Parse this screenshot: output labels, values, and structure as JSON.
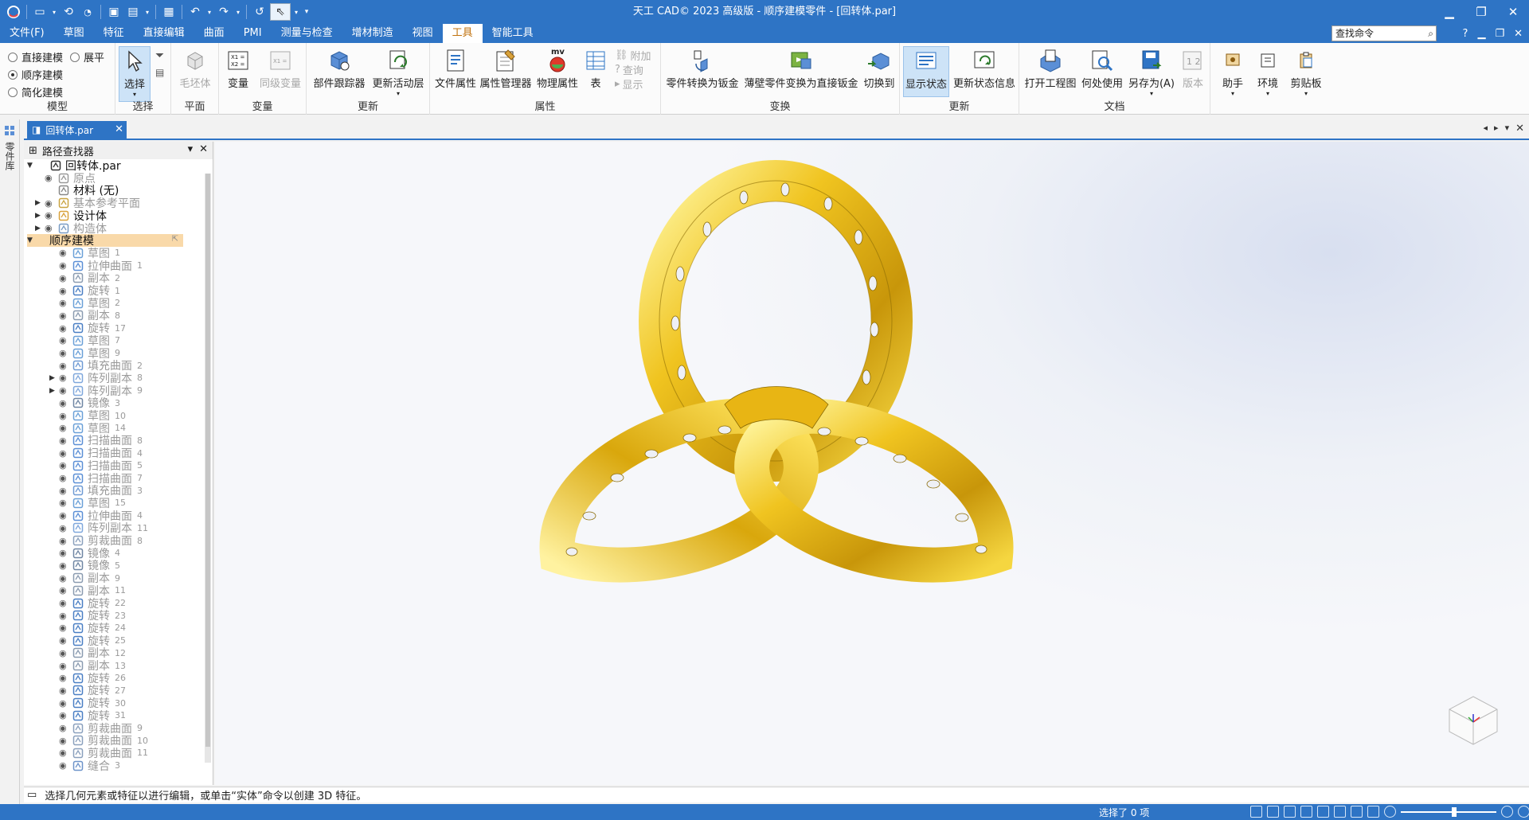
{
  "app": {
    "title": "天工 CAD© 2023 高级版 - 顺序建模零件 - [回转体.par]"
  },
  "menu": {
    "items": [
      "文件(F)",
      "草图",
      "特征",
      "直接编辑",
      "曲面",
      "PMI",
      "测量与检查",
      "增材制造",
      "视图",
      "工具",
      "智能工具"
    ],
    "active_index": 9,
    "search_placeholder": "查找命令",
    "help": "?"
  },
  "ribbon": {
    "model": {
      "opt1": "直接建模",
      "opt2": "展平",
      "opt3": "顺序建模",
      "opt4": "简化建模",
      "label": "模型"
    },
    "select": {
      "btn": "选择",
      "label": "选择"
    },
    "plane": {
      "btn": "毛坯体",
      "label": "平面"
    },
    "variable": {
      "btn1": "变量",
      "btn2": "同级变量",
      "label": "变量"
    },
    "update": {
      "btn1": "部件跟踪器",
      "btn2": "更新活动层",
      "label": "更新"
    },
    "props": {
      "btn1": "文件属性",
      "btn2": "属性管理器",
      "btn3": "物理属性",
      "btn4": "表",
      "small1": "附加",
      "small2": "查询",
      "small3": "显示",
      "mv": "mv",
      "label": "属性"
    },
    "convert": {
      "btn1": "零件转换为钣金",
      "btn2": "薄壁零件变换为直接钣金",
      "btn3": "切换到",
      "label": "变换"
    },
    "update2": {
      "btn1": "显示状态",
      "btn2": "更新状态信息",
      "label": "更新"
    },
    "docs": {
      "btn1": "打开工程图",
      "btn2": "何处使用",
      "btn3": "另存为(A)",
      "btn4": "版本",
      "label": "文档"
    },
    "extra": {
      "btn1": "助手",
      "btn2": "环境",
      "btn3": "剪贴板"
    }
  },
  "leftstrip": {
    "tab": "零件库"
  },
  "doc": {
    "tab": "回转体.par"
  },
  "pathfinder": {
    "title": "路径查找器",
    "tree": [
      {
        "label": "回转体.par",
        "num": "",
        "depth": 0,
        "twisty": "open",
        "style": "dark",
        "icon": "part-icon",
        "eye": false
      },
      {
        "label": "原点",
        "num": "",
        "depth": 1,
        "twisty": "",
        "style": "dim",
        "icon": "origin-icon",
        "eye": true
      },
      {
        "label": "材料 (无)",
        "num": "",
        "depth": 1,
        "twisty": "",
        "style": "dark",
        "icon": "material-icon",
        "eye": false
      },
      {
        "label": "基本参考平面",
        "num": "",
        "depth": 1,
        "twisty": "closed",
        "style": "dim",
        "icon": "plane-icon",
        "eye": true
      },
      {
        "label": "设计体",
        "num": "",
        "depth": 1,
        "twisty": "closed",
        "style": "dark",
        "icon": "design-body-icon",
        "eye": true
      },
      {
        "label": "构造体",
        "num": "",
        "depth": 1,
        "twisty": "closed",
        "style": "dim",
        "icon": "construction-icon",
        "eye": true
      },
      {
        "label": "顺序建模",
        "num": "",
        "depth": 0,
        "twisty": "open",
        "style": "hl",
        "icon": "",
        "eye": false
      },
      {
        "label": "草图",
        "num": "1",
        "depth": 2,
        "twisty": "",
        "style": "dim",
        "icon": "sketch-icon",
        "eye": true
      },
      {
        "label": "拉伸曲面",
        "num": "1",
        "depth": 2,
        "twisty": "",
        "style": "dim",
        "icon": "extrude-surface-icon",
        "eye": true
      },
      {
        "label": "副本",
        "num": "2",
        "depth": 2,
        "twisty": "",
        "style": "dim",
        "icon": "copy-icon",
        "eye": true
      },
      {
        "label": "旋转",
        "num": "1",
        "depth": 2,
        "twisty": "",
        "style": "dim",
        "icon": "revolve-icon",
        "eye": true
      },
      {
        "label": "草图",
        "num": "2",
        "depth": 2,
        "twisty": "",
        "style": "dim",
        "icon": "sketch-icon",
        "eye": true
      },
      {
        "label": "副本",
        "num": "8",
        "depth": 2,
        "twisty": "",
        "style": "dim",
        "icon": "copy-icon",
        "eye": true
      },
      {
        "label": "旋转",
        "num": "17",
        "depth": 2,
        "twisty": "",
        "style": "dim",
        "icon": "revolve-icon",
        "eye": true
      },
      {
        "label": "草图",
        "num": "7",
        "depth": 2,
        "twisty": "",
        "style": "dim",
        "icon": "sketch-icon",
        "eye": true
      },
      {
        "label": "草图",
        "num": "9",
        "depth": 2,
        "twisty": "",
        "style": "dim",
        "icon": "sketch-icon",
        "eye": true
      },
      {
        "label": "填充曲面",
        "num": "2",
        "depth": 2,
        "twisty": "",
        "style": "dim",
        "icon": "fill-surface-icon",
        "eye": true
      },
      {
        "label": "阵列副本",
        "num": "8",
        "depth": 2,
        "twisty": "closed",
        "style": "dim",
        "icon": "pattern-copy-icon",
        "eye": true
      },
      {
        "label": "阵列副本",
        "num": "9",
        "depth": 2,
        "twisty": "closed",
        "style": "dim",
        "icon": "pattern-copy-icon",
        "eye": true
      },
      {
        "label": "镜像",
        "num": "3",
        "depth": 2,
        "twisty": "",
        "style": "dim",
        "icon": "mirror-icon",
        "eye": true
      },
      {
        "label": "草图",
        "num": "10",
        "depth": 2,
        "twisty": "",
        "style": "dim",
        "icon": "sketch-icon",
        "eye": true
      },
      {
        "label": "草图",
        "num": "14",
        "depth": 2,
        "twisty": "",
        "style": "dim",
        "icon": "sketch-icon",
        "eye": true
      },
      {
        "label": "扫描曲面",
        "num": "8",
        "depth": 2,
        "twisty": "",
        "style": "dim",
        "icon": "sweep-surface-icon",
        "eye": true
      },
      {
        "label": "扫描曲面",
        "num": "4",
        "depth": 2,
        "twisty": "",
        "style": "dim",
        "icon": "sweep-surface-icon",
        "eye": true
      },
      {
        "label": "扫描曲面",
        "num": "5",
        "depth": 2,
        "twisty": "",
        "style": "dim",
        "icon": "sweep-surface-icon",
        "eye": true
      },
      {
        "label": "扫描曲面",
        "num": "7",
        "depth": 2,
        "twisty": "",
        "style": "dim",
        "icon": "sweep-surface-icon",
        "eye": true
      },
      {
        "label": "填充曲面",
        "num": "3",
        "depth": 2,
        "twisty": "",
        "style": "dim",
        "icon": "fill-surface-icon",
        "eye": true
      },
      {
        "label": "草图",
        "num": "15",
        "depth": 2,
        "twisty": "",
        "style": "dim",
        "icon": "sketch-icon",
        "eye": true
      },
      {
        "label": "拉伸曲面",
        "num": "4",
        "depth": 2,
        "twisty": "",
        "style": "dim",
        "icon": "extrude-surface-icon",
        "eye": true
      },
      {
        "label": "阵列副本",
        "num": "11",
        "depth": 2,
        "twisty": "",
        "style": "dim",
        "icon": "pattern-copy-icon",
        "eye": true
      },
      {
        "label": "剪裁曲面",
        "num": "8",
        "depth": 2,
        "twisty": "",
        "style": "dim",
        "icon": "trim-surface-icon",
        "eye": true
      },
      {
        "label": "镜像",
        "num": "4",
        "depth": 2,
        "twisty": "",
        "style": "dim",
        "icon": "mirror-icon",
        "eye": true
      },
      {
        "label": "镜像",
        "num": "5",
        "depth": 2,
        "twisty": "",
        "style": "dim",
        "icon": "mirror-icon",
        "eye": true
      },
      {
        "label": "副本",
        "num": "9",
        "depth": 2,
        "twisty": "",
        "style": "dim",
        "icon": "copy-icon",
        "eye": true
      },
      {
        "label": "副本",
        "num": "11",
        "depth": 2,
        "twisty": "",
        "style": "dim",
        "icon": "copy-icon",
        "eye": true
      },
      {
        "label": "旋转",
        "num": "22",
        "depth": 2,
        "twisty": "",
        "style": "dim",
        "icon": "revolve-icon",
        "eye": true
      },
      {
        "label": "旋转",
        "num": "23",
        "depth": 2,
        "twisty": "",
        "style": "dim",
        "icon": "revolve-icon",
        "eye": true
      },
      {
        "label": "旋转",
        "num": "24",
        "depth": 2,
        "twisty": "",
        "style": "dim",
        "icon": "revolve-icon",
        "eye": true
      },
      {
        "label": "旋转",
        "num": "25",
        "depth": 2,
        "twisty": "",
        "style": "dim",
        "icon": "revolve-icon",
        "eye": true
      },
      {
        "label": "副本",
        "num": "12",
        "depth": 2,
        "twisty": "",
        "style": "dim",
        "icon": "copy-icon",
        "eye": true
      },
      {
        "label": "副本",
        "num": "13",
        "depth": 2,
        "twisty": "",
        "style": "dim",
        "icon": "copy-icon",
        "eye": true
      },
      {
        "label": "旋转",
        "num": "26",
        "depth": 2,
        "twisty": "",
        "style": "dim",
        "icon": "revolve-icon",
        "eye": true
      },
      {
        "label": "旋转",
        "num": "27",
        "depth": 2,
        "twisty": "",
        "style": "dim",
        "icon": "revolve-icon",
        "eye": true
      },
      {
        "label": "旋转",
        "num": "30",
        "depth": 2,
        "twisty": "",
        "style": "dim",
        "icon": "revolve-icon",
        "eye": true
      },
      {
        "label": "旋转",
        "num": "31",
        "depth": 2,
        "twisty": "",
        "style": "dim",
        "icon": "revolve-icon",
        "eye": true
      },
      {
        "label": "剪裁曲面",
        "num": "9",
        "depth": 2,
        "twisty": "",
        "style": "dim",
        "icon": "trim-surface-icon",
        "eye": true
      },
      {
        "label": "剪裁曲面",
        "num": "10",
        "depth": 2,
        "twisty": "",
        "style": "dim",
        "icon": "trim-surface-icon",
        "eye": true
      },
      {
        "label": "剪裁曲面",
        "num": "11",
        "depth": 2,
        "twisty": "",
        "style": "dim",
        "icon": "trim-surface-icon",
        "eye": true
      },
      {
        "label": "缝合",
        "num": "3",
        "depth": 2,
        "twisty": "",
        "style": "dim",
        "icon": "stitch-icon",
        "eye": true
      }
    ]
  },
  "hint": {
    "text": "选择几何元素或特征以进行编辑，或单击“实体”命令以创建 3D 特征。"
  },
  "status": {
    "selected": "选择了 0 项"
  },
  "colors": {
    "accent": "#2e74c5",
    "highlight": "#f9d9a9",
    "gold": "#e6b800"
  }
}
